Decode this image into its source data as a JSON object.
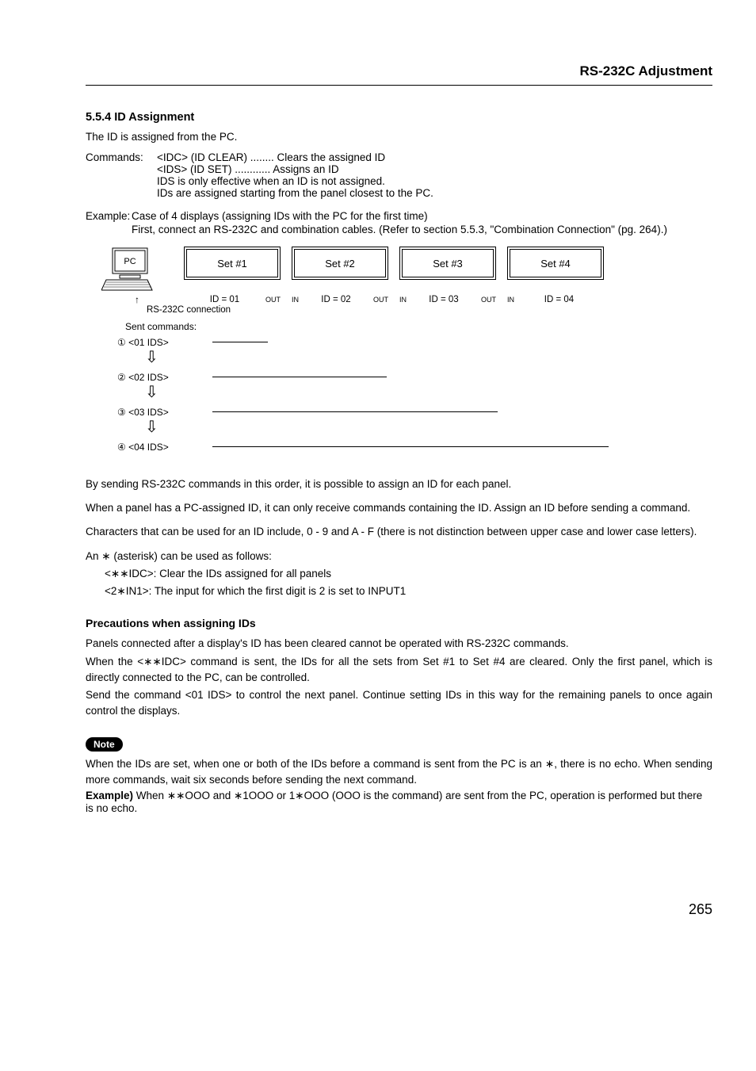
{
  "header": {
    "title": "RS-232C Adjustment"
  },
  "section": {
    "num_title": "5.5.4 ID Assignment",
    "intro": "The ID is assigned from the PC.",
    "commands_label": "Commands:",
    "cmd1": "<IDC> (ID CLEAR) ........ Clears the assigned ID",
    "cmd2": "<IDS> (ID SET) ............ Assigns an ID",
    "cmd3": "IDS is only effective when an ID is not assigned.",
    "cmd4": "IDs are assigned starting from the panel closest to the PC.",
    "example_label": "Example:",
    "example_l1": "Case of 4 displays (assigning IDs with the PC for the first time)",
    "example_l2": "First, connect an RS-232C and combination cables. (Refer to section 5.5.3, \"Combination Connection\" (pg. 264).)"
  },
  "diagram": {
    "pc_label": "PC",
    "sets": [
      {
        "name": "Set #1",
        "id": "ID = 01",
        "in": "",
        "out": "OUT"
      },
      {
        "name": "Set #2",
        "id": "ID = 02",
        "in": "IN",
        "out": "OUT"
      },
      {
        "name": "Set #3",
        "id": "ID = 03",
        "in": "IN",
        "out": "OUT"
      },
      {
        "name": "Set #4",
        "id": "ID = 04",
        "in": "IN",
        "out": ""
      }
    ],
    "rs232_label": "RS-232C connection",
    "sent_label": "Sent commands:",
    "steps": [
      "① <01 IDS>",
      "② <02 IDS>",
      "③ <03 IDS>",
      "④ <04 IDS>"
    ]
  },
  "body": {
    "p1": "By sending RS-232C commands in this order, it is possible to assign an ID for each panel.",
    "p2": "When a panel has a PC-assigned ID, it can only receive commands containing the ID. Assign an ID before sending a command.",
    "p3": "Characters that can be used for an ID include, 0 - 9 and A - F (there is not distinction between upper case and lower case letters).",
    "p4": "An ∗ (asterisk) can be used as follows:",
    "p4a": "<∗∗IDC>:  Clear the IDs assigned for all panels",
    "p4b": "<2∗IN1>: The input for which the first digit is 2 is set to INPUT1"
  },
  "precautions": {
    "title": "Precautions when assigning IDs",
    "p1": "Panels connected after a display's ID has been cleared cannot be operated with RS-232C commands.",
    "p2": "When the <∗∗IDC> command is sent, the IDs for all the sets from Set #1 to Set #4 are cleared. Only the first panel, which is directly connected to the PC, can be controlled.",
    "p3": "Send the command <01 IDS> to control the next panel. Continue setting IDs in this way for the remaining panels to once again control the displays."
  },
  "note": {
    "label": "Note",
    "p1": "When the IDs are set, when one or both of the IDs before a command is sent from the PC is an ∗, there is no echo. When sending more commands, wait six seconds before sending the next command.",
    "ex_label": "Example)",
    "ex_body": "When ∗∗OOO and ∗1OOO or 1∗OOO (OOO is the command) are sent from the PC, operation is performed but there is no echo."
  },
  "page_number": "265"
}
